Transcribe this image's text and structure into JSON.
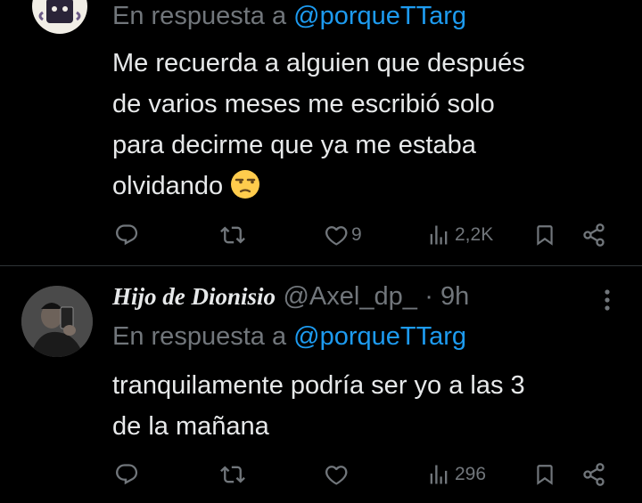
{
  "tweet1": {
    "reply_prefix": "En respuesta a ",
    "reply_handle": "@porqueTTarg",
    "text_lines": [
      "Me recuerda a alguien que después",
      "de varios meses me escribió solo",
      "para decirme que ya me estaba",
      "olvidando"
    ],
    "emoji": "unamused-face",
    "likes": "9",
    "views": "2,2K"
  },
  "tweet2": {
    "name": "Hijo de Dionisio",
    "handle": "@Axel_dp_",
    "time": "· 9h",
    "reply_prefix": "En respuesta a ",
    "reply_handle": "@porqueTTarg",
    "text_lines": [
      "tranquilamente podría ser yo a las 3",
      "de la mañana"
    ],
    "views": "296"
  },
  "colors": {
    "background": "#000000",
    "text": "#e7e9ea",
    "muted": "#71767b",
    "accent": "#1d9bf0",
    "divider": "#2f3336"
  },
  "icons": [
    "reply-icon",
    "retweet-icon",
    "like-icon",
    "views-icon",
    "bookmark-icon",
    "share-icon",
    "more-icon"
  ]
}
